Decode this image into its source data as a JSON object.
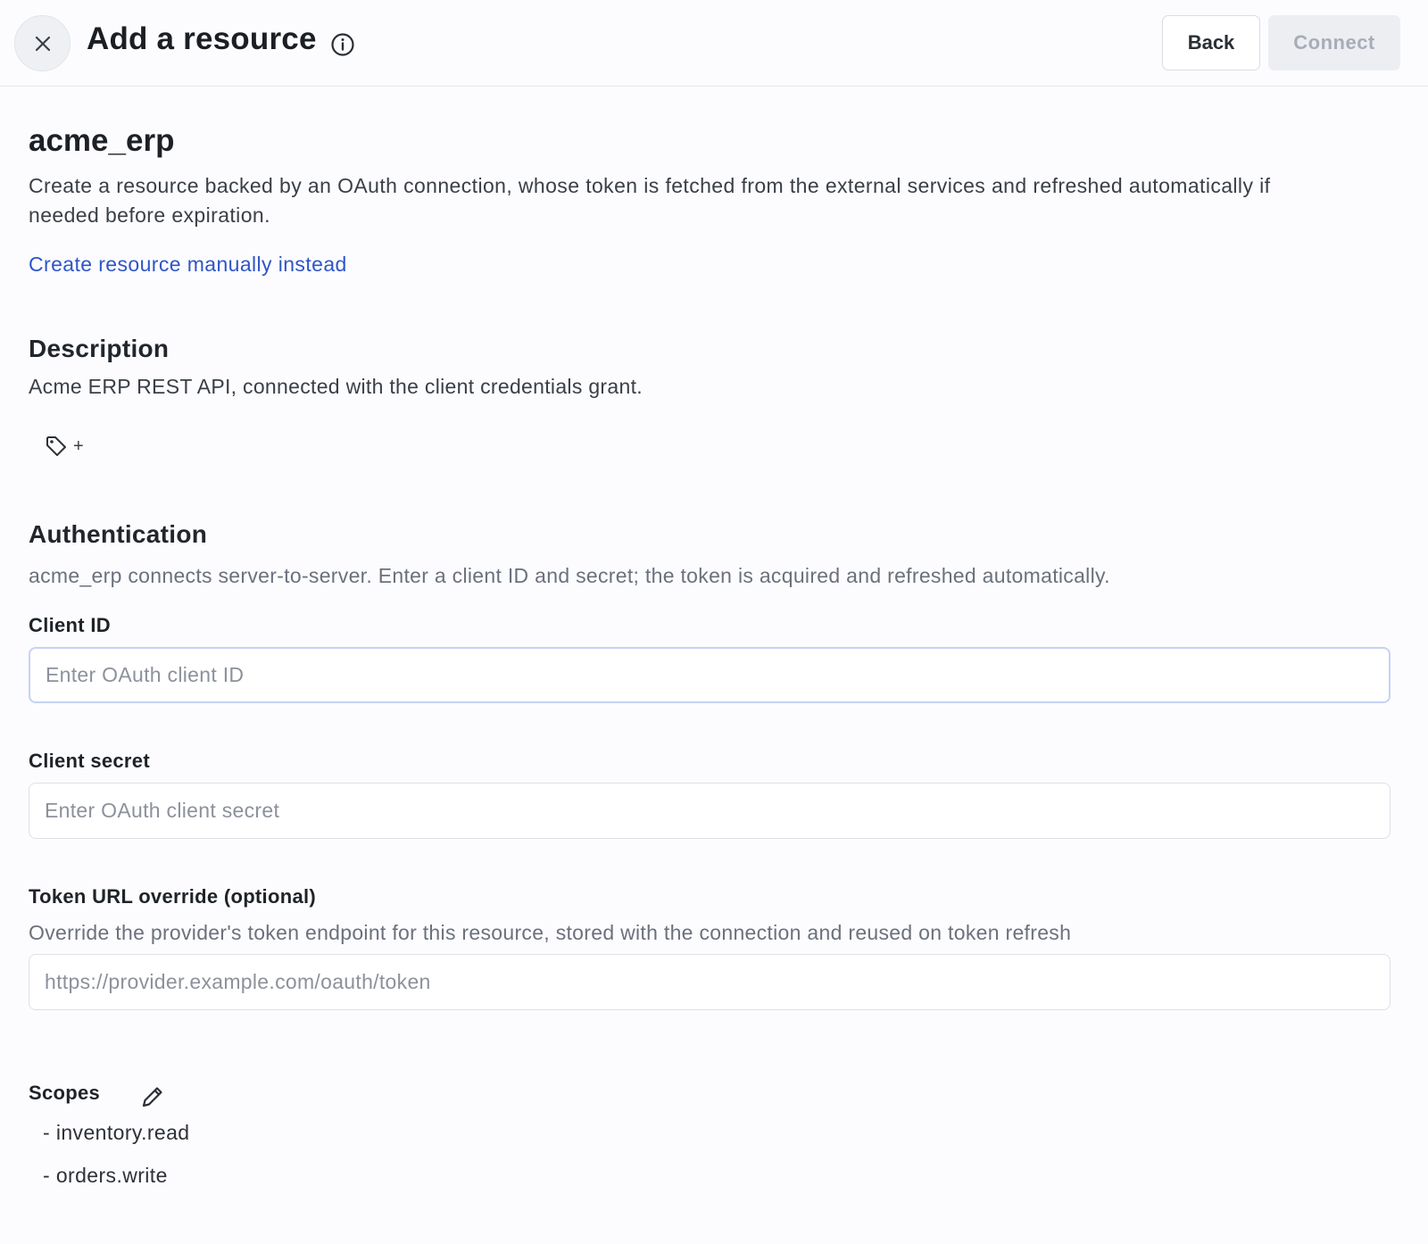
{
  "header": {
    "title": "Add a resource",
    "back_label": "Back",
    "connect_label": "Connect"
  },
  "resource": {
    "name": "acme_erp",
    "description": "Create a resource backed by an OAuth connection, whose token is fetched from the external services and refreshed automatically if needed before expiration.",
    "manual_link": "Create resource manually instead"
  },
  "description_section": {
    "heading": "Description",
    "text": "Acme ERP REST API, connected with the client credentials grant.",
    "tag_add_label": "+"
  },
  "authentication": {
    "heading": "Authentication",
    "help": "acme_erp connects server-to-server. Enter a client ID and secret; the token is acquired and refreshed automatically.",
    "client_id": {
      "label": "Client ID",
      "value": "",
      "placeholder": "Enter OAuth client ID"
    },
    "client_secret": {
      "label": "Client secret",
      "value": "",
      "placeholder": "Enter OAuth client secret"
    },
    "token_url": {
      "label": "Token URL override (optional)",
      "help": "Override the provider's token endpoint for this resource, stored with the connection and reused on token refresh",
      "value": "",
      "placeholder": "https://provider.example.com/oauth/token"
    }
  },
  "scopes": {
    "heading": "Scopes",
    "items": [
      "- inventory.read",
      "- orders.write"
    ]
  },
  "icons": {
    "close": "close-icon",
    "info": "info-icon",
    "tag": "tag-icon",
    "edit": "pencil-icon"
  }
}
